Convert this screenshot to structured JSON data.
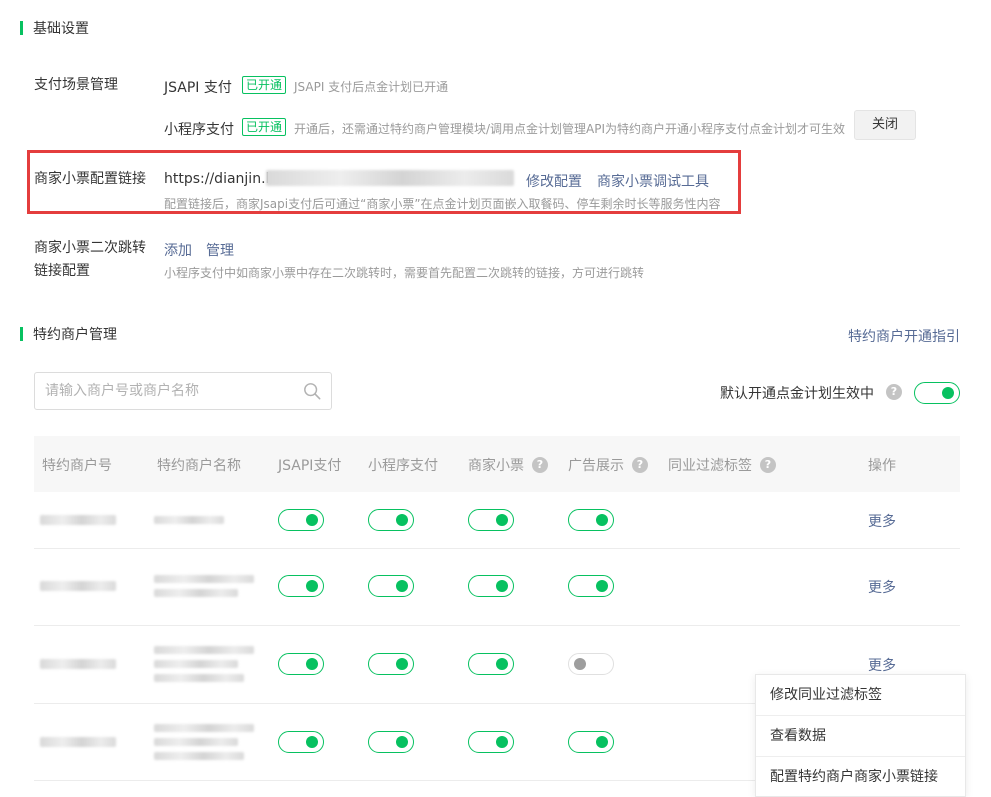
{
  "basic_settings": {
    "title": "基础设置",
    "pay_scene": {
      "label": "支付场景管理",
      "jsapi": {
        "name": "JSAPI 支付",
        "status": "已开通",
        "hint": "JSAPI 支付后点金计划已开通"
      },
      "miniprogram": {
        "name": "小程序支付",
        "status": "已开通",
        "hint": "开通后，还需通过特约商户管理模块/调用点金计划管理API为特约商户开通小程序支付点金计划才可生效",
        "close_label": "关闭"
      }
    },
    "receipt_link": {
      "label": "商家小票配置链接",
      "url_visible": "https://dianjin.lor",
      "modify_label": "修改配置",
      "debug_tool_label": "商家小票调试工具",
      "hint": "配置链接后，商家Jsapi支付后可通过“商家小票”在点金计划页面嵌入取餐码、停车剩余时长等服务性内容"
    },
    "secondary_jump": {
      "label_line1": "商家小票二次跳转",
      "label_line2": "链接配置",
      "add_label": "添加",
      "manage_label": "管理",
      "hint": "小程序支付中如商家小票中存在二次跳转时，需要首先配置二次跳转的链接，方可进行跳转"
    }
  },
  "merchant_mgmt": {
    "title": "特约商户管理",
    "guide_link": "特约商户开通指引",
    "search_placeholder": "请输入商户号或商户名称",
    "default_toggle_label": "默认开通点金计划生效中",
    "default_toggle_on": true,
    "table": {
      "headers": {
        "merchant_id": "特约商户号",
        "merchant_name": "特约商户名称",
        "jsapi": "JSAPI支付",
        "miniprogram": "小程序支付",
        "receipt": "商家小票",
        "ad": "广告展示",
        "industry_filter": "同业过滤标签",
        "action": "操作"
      },
      "rows": [
        {
          "jsapi": true,
          "miniprogram": true,
          "receipt": true,
          "ad": true,
          "action": "更多"
        },
        {
          "jsapi": true,
          "miniprogram": true,
          "receipt": true,
          "ad": true,
          "action": "更多"
        },
        {
          "jsapi": true,
          "miniprogram": true,
          "receipt": true,
          "ad": false,
          "action": "更多"
        },
        {
          "jsapi": true,
          "miniprogram": true,
          "receipt": true,
          "ad": true,
          "action": ""
        }
      ]
    },
    "more_menu": [
      "修改同业过滤标签",
      "查看数据",
      "配置特约商户商家小票链接"
    ]
  },
  "colors": {
    "accent": "#07c160",
    "link": "#576b95",
    "highlight_border": "#e43d3d"
  }
}
